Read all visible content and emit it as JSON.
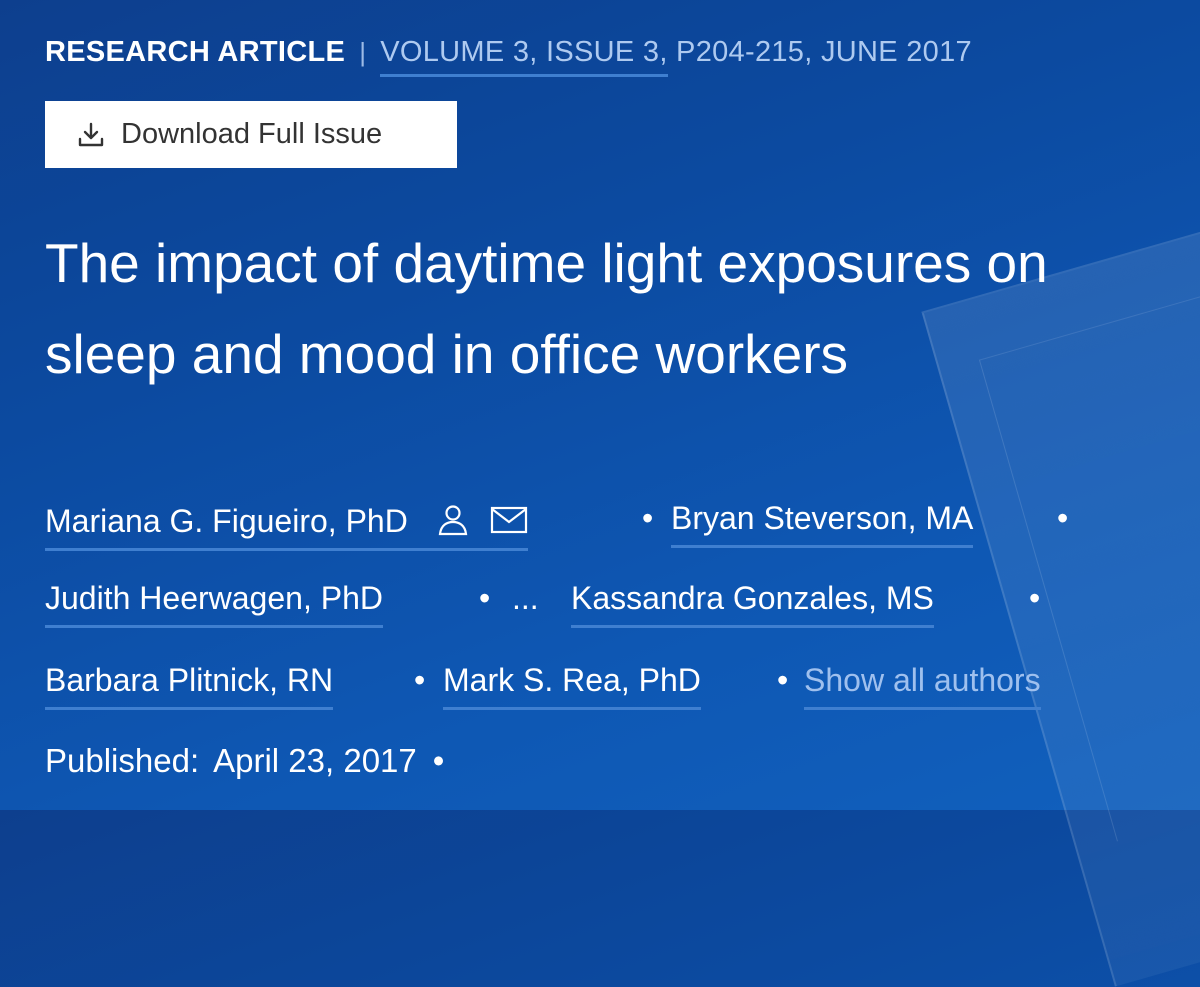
{
  "article": {
    "type_label": "RESEARCH ARTICLE",
    "separator": "|",
    "volume_issue": "VOLUME 3, ISSUE 3,",
    "pages_date": " P204-215, JUNE 2017"
  },
  "download": {
    "label": "Download Full Issue",
    "icon": "download-icon"
  },
  "title": "The impact of daytime light exposures on sleep and mood in office workers",
  "authors": [
    {
      "name": "Mariana G. Figueiro, PhD"
    },
    {
      "name": "Bryan Steverson, MA"
    },
    {
      "name": "Judith Heerwagen, PhD"
    },
    {
      "name": "Kassandra Gonzales, MS"
    },
    {
      "name": "Barbara Plitnick, RN"
    },
    {
      "name": "Mark S. Rea, PhD"
    }
  ],
  "author_icons": [
    "person-icon",
    "mail-icon"
  ],
  "bullet": "•",
  "ellipsis": "...",
  "show_all_label": "Show all authors",
  "published": {
    "label": "Published:",
    "date": "April 23, 2017",
    "bullet": "•"
  },
  "colors": {
    "background": "#0c4aa0",
    "link_underline": "#3f7fd0",
    "muted_link": "#9fc0ee"
  }
}
